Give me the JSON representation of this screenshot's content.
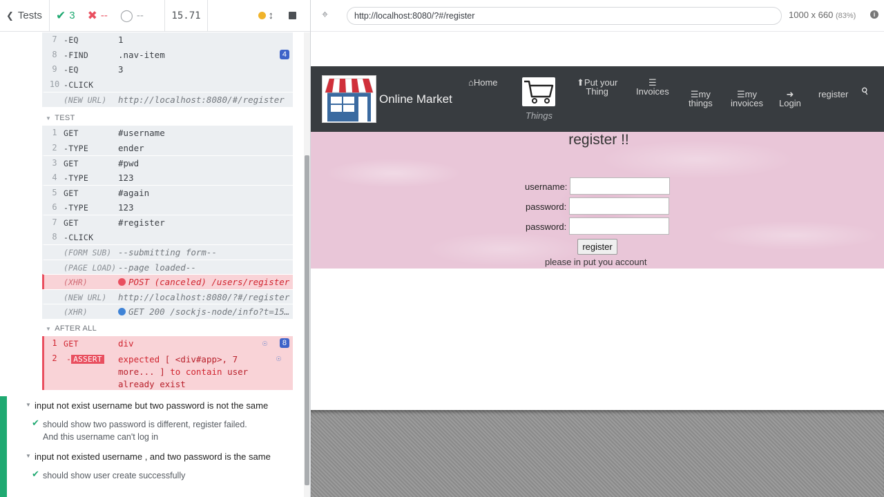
{
  "reporter": {
    "tests_label": "Tests",
    "passed": "3",
    "failed": "--",
    "pending": "--",
    "duration": "15.71"
  },
  "commands_top": [
    {
      "num": "7",
      "name": "-EQ",
      "msg": "1"
    },
    {
      "num": "8",
      "name": "-FIND",
      "msg": ".nav-item",
      "badge": "4"
    },
    {
      "num": "9",
      "name": "-EQ",
      "msg": "3"
    },
    {
      "num": "10",
      "name": "-CLICK",
      "msg": ""
    },
    {
      "num": "",
      "pre": "(NEW URL)",
      "msg": "http://localhost:8080/#/register"
    }
  ],
  "test_hook": "TEST",
  "test_commands": [
    {
      "num": "1",
      "name": "GET",
      "msg": "#username"
    },
    {
      "num": "2",
      "name": "-TYPE",
      "msg": "ender"
    },
    {
      "num": "3",
      "name": "GET",
      "msg": "#pwd"
    },
    {
      "num": "4",
      "name": "-TYPE",
      "msg": "123"
    },
    {
      "num": "5",
      "name": "GET",
      "msg": "#again"
    },
    {
      "num": "6",
      "name": "-TYPE",
      "msg": "123"
    },
    {
      "num": "7",
      "name": "GET",
      "msg": "#register"
    },
    {
      "num": "8",
      "name": "-CLICK",
      "msg": ""
    },
    {
      "pre": "(FORM SUB)",
      "msg": "--submitting form--"
    },
    {
      "pre": "(PAGE LOAD)",
      "msg": "--page loaded--"
    },
    {
      "pre": "(XHR)",
      "msg": "POST (canceled) /users/register"
    },
    {
      "pre": "(NEW URL)",
      "msg": "http://localhost:8080/?#/register"
    },
    {
      "pre": "(XHR)",
      "msg": "GET 200 /sockjs-node/info?t=157..."
    }
  ],
  "after_hook": "AFTER ALL",
  "after_commands": {
    "get_num": "1",
    "get_name": "GET",
    "get_msg": "div",
    "get_badge": "8",
    "assert_num": "2",
    "assert_name": "ASSERT",
    "assert_msg_1": "expected",
    "assert_msg_2": "[ <div#app>, 7",
    "assert_msg_3": "more... ]",
    "assert_msg_4": "to contain",
    "assert_msg_5": "user",
    "assert_msg_6": "already exist"
  },
  "suites": [
    {
      "title": "input not exist username but two password is not the same",
      "test_1": "should show two password is different, register failed.",
      "test_2": "And this username can't log in"
    },
    {
      "title": "input not existed username , and two password is the same",
      "test_1": "should show user create successfully"
    }
  ],
  "preview": {
    "url": "http://localhost:8080/?#/register",
    "viewport": "1000 x 660",
    "scale": "(83%)"
  },
  "app": {
    "brand": "Online Market",
    "nav": {
      "home": "Home",
      "put_1": "Put your",
      "put_2": "Thing",
      "things": "Things",
      "invoices": "Invoices",
      "my_things_1": "my",
      "my_things_2": "things",
      "my_invoices_1": "my",
      "my_invoices_2": "invoices",
      "login": "Login",
      "register": "register"
    },
    "heading": "register !!",
    "form": {
      "username_label": "username:",
      "password_label": "password:",
      "again_label": "password:",
      "button": "register",
      "message": "please in put you account"
    }
  },
  "colors": {
    "pass": "#1fa971",
    "fail": "#e94f5f",
    "navbar": "#383c40",
    "banner": "#e9c6d8"
  }
}
